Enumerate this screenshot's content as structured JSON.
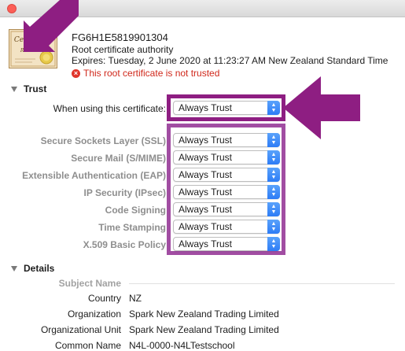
{
  "certificate": {
    "name": "FG6H1E5819901304",
    "kind": "Root certificate authority",
    "expires": "Expires: Tuesday, 2 June 2020 at 11:23:27 AM New Zealand Standard Time",
    "warning": "This root certificate is not trusted",
    "icon_text": "Certificate",
    "icon_subtext": "Root"
  },
  "trust": {
    "section_title": "Trust",
    "main_label": "When using this certificate:",
    "main_value": "Always Trust",
    "rows": [
      {
        "label": "Secure Sockets Layer (SSL)",
        "value": "Always Trust"
      },
      {
        "label": "Secure Mail (S/MIME)",
        "value": "Always Trust"
      },
      {
        "label": "Extensible Authentication (EAP)",
        "value": "Always Trust"
      },
      {
        "label": "IP Security (IPsec)",
        "value": "Always Trust"
      },
      {
        "label": "Code Signing",
        "value": "Always Trust"
      },
      {
        "label": "Time Stamping",
        "value": "Always Trust"
      },
      {
        "label": "X.509 Basic Policy",
        "value": "Always Trust"
      }
    ]
  },
  "details": {
    "section_title": "Details",
    "subject_heading": "Subject Name",
    "fields": [
      {
        "label": "Country",
        "value": "NZ"
      },
      {
        "label": "Organization",
        "value": "Spark New Zealand Trading Limited"
      },
      {
        "label": "Organizational Unit",
        "value": "Spark New Zealand Trading Limited"
      },
      {
        "label": "Common Name",
        "value": "N4L-0000-N4LTestschool"
      }
    ]
  },
  "colors": {
    "highlight": "#8e1e82",
    "warning": "#d0281b",
    "popup_accent": "#2d7cf6"
  }
}
